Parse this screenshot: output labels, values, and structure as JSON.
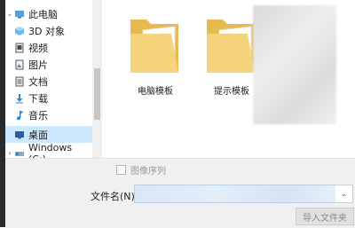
{
  "sidebar": {
    "items": [
      {
        "label": "此电脑",
        "icon": "pc-icon",
        "expander": "⌄"
      },
      {
        "label": "3D 对象",
        "icon": "3d-objects-icon"
      },
      {
        "label": "视频",
        "icon": "video-icon"
      },
      {
        "label": "图片",
        "icon": "picture-icon"
      },
      {
        "label": "文档",
        "icon": "document-icon"
      },
      {
        "label": "下载",
        "icon": "download-icon"
      },
      {
        "label": "音乐",
        "icon": "music-icon"
      },
      {
        "label": "桌面",
        "icon": "desktop-icon"
      },
      {
        "label": "Windows (C:)",
        "icon": "drive-icon",
        "expander": "›"
      }
    ]
  },
  "main": {
    "folders": [
      {
        "label": "电脑模板"
      },
      {
        "label": "提示模板"
      }
    ]
  },
  "bottom": {
    "sequence_checkbox_label": "图像序列",
    "filename_label": "文件名(N):",
    "filename_value": "",
    "dropdown_arrow": "⌄",
    "import_button": "导入文件夹"
  },
  "colors": {
    "selection": "#cce8ff",
    "folder": "#f3cf73"
  }
}
